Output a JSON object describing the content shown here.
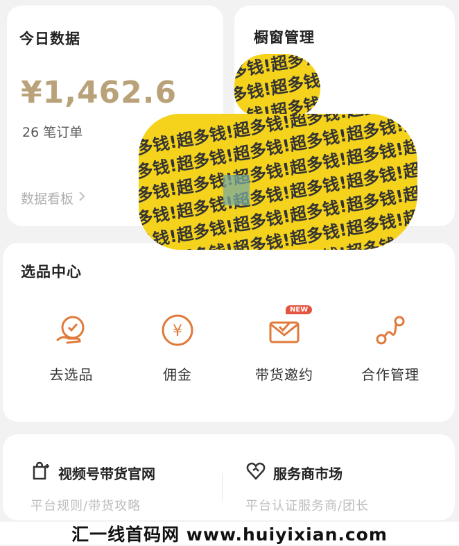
{
  "today": {
    "title": "今日数据",
    "revenue": "¥1,462.6",
    "orders": "26 笔订单",
    "dashboard_link": "数据看板"
  },
  "window": {
    "title": "橱窗管理"
  },
  "sticker": {
    "text": "超多钱!超多钱!超多钱!超多钱!超多钱!超多钱!超多钱!",
    "color": "#f5d31c"
  },
  "select_center": {
    "title": "选品中心",
    "items": [
      {
        "label": "去选品",
        "icon": "hand-coin-icon"
      },
      {
        "label": "佣金",
        "icon": "yen-coin-icon"
      },
      {
        "label": "带货邀约",
        "icon": "envelope-check-icon",
        "badge": "NEW"
      },
      {
        "label": "合作管理",
        "icon": "connection-icon"
      }
    ]
  },
  "links": [
    {
      "title": "视频号带货官网",
      "subtitle": "平台规则/带货攻略",
      "icon": "video-bag-icon"
    },
    {
      "title": "服务商市场",
      "subtitle": "平台认证服务商/团长",
      "icon": "heart-handshake-icon"
    }
  ],
  "watermark": "汇一线首码网 www.huiyixian.com",
  "colors": {
    "accent_orange": "#e07a3a",
    "gold": "#b9a27a",
    "badge_red": "#e4553f",
    "sticker_yellow": "#f5d31c"
  }
}
